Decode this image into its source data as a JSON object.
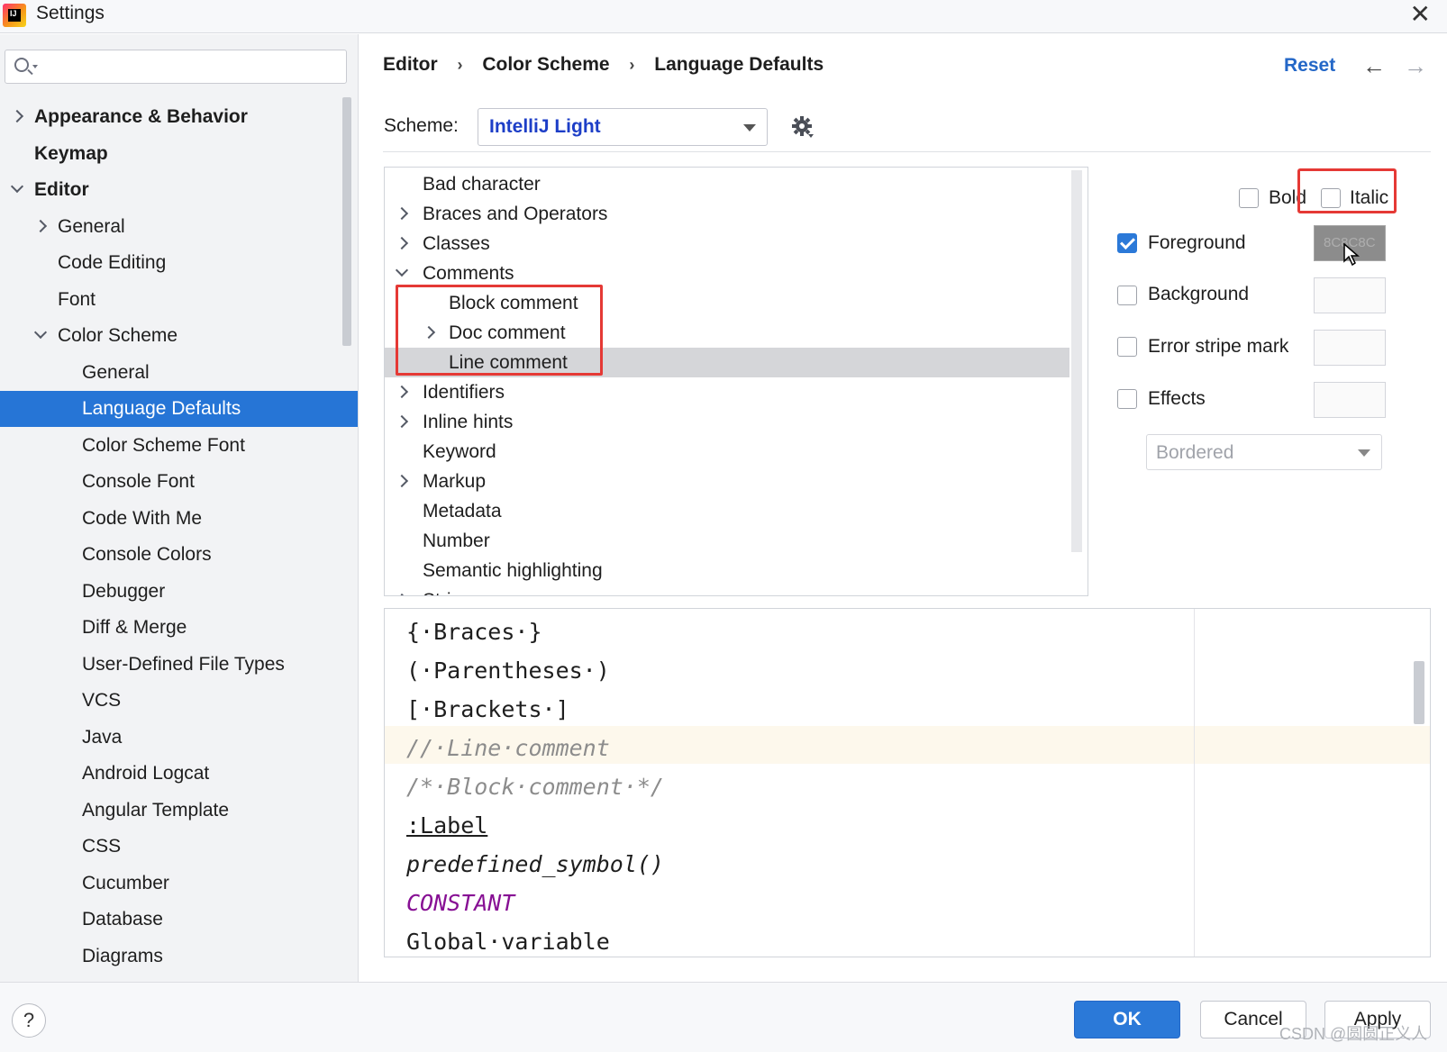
{
  "window": {
    "title": "Settings",
    "close_glyph": "✕"
  },
  "app_logo": {
    "icon": "intellij-logo-icon",
    "text": "IJ"
  },
  "search": {
    "value": "",
    "placeholder": ""
  },
  "sidebar": {
    "items": [
      {
        "label": "Appearance & Behavior",
        "level": 0,
        "arrow": "right",
        "bold": true
      },
      {
        "label": "Keymap",
        "level": 0,
        "arrow": "none",
        "bold": true
      },
      {
        "label": "Editor",
        "level": 0,
        "arrow": "down",
        "bold": true
      },
      {
        "label": "General",
        "level": 1,
        "arrow": "right"
      },
      {
        "label": "Code Editing",
        "level": 1,
        "arrow": "none"
      },
      {
        "label": "Font",
        "level": 1,
        "arrow": "none"
      },
      {
        "label": "Color Scheme",
        "level": 1,
        "arrow": "down"
      },
      {
        "label": "General",
        "level": 2,
        "arrow": "none"
      },
      {
        "label": "Language Defaults",
        "level": 2,
        "arrow": "none",
        "selected": true
      },
      {
        "label": "Color Scheme Font",
        "level": 2,
        "arrow": "none"
      },
      {
        "label": "Console Font",
        "level": 2,
        "arrow": "none"
      },
      {
        "label": "Code With Me",
        "level": 2,
        "arrow": "none"
      },
      {
        "label": "Console Colors",
        "level": 2,
        "arrow": "none"
      },
      {
        "label": "Debugger",
        "level": 2,
        "arrow": "none"
      },
      {
        "label": "Diff & Merge",
        "level": 2,
        "arrow": "none"
      },
      {
        "label": "User-Defined File Types",
        "level": 2,
        "arrow": "none"
      },
      {
        "label": "VCS",
        "level": 2,
        "arrow": "none"
      },
      {
        "label": "Java",
        "level": 2,
        "arrow": "none"
      },
      {
        "label": "Android Logcat",
        "level": 2,
        "arrow": "none"
      },
      {
        "label": "Angular Template",
        "level": 2,
        "arrow": "none"
      },
      {
        "label": "CSS",
        "level": 2,
        "arrow": "none"
      },
      {
        "label": "Cucumber",
        "level": 2,
        "arrow": "none"
      },
      {
        "label": "Database",
        "level": 2,
        "arrow": "none"
      },
      {
        "label": "Diagrams",
        "level": 2,
        "arrow": "none"
      }
    ]
  },
  "breadcrumb": {
    "items": [
      "Editor",
      "Color Scheme",
      "Language Defaults"
    ],
    "separator": "›"
  },
  "header": {
    "reset_label": "Reset",
    "back_glyph": "←",
    "forward_glyph": "→"
  },
  "scheme": {
    "label": "Scheme:",
    "value": "IntelliJ Light"
  },
  "attributes": {
    "rows": [
      {
        "label": "Bad character",
        "level": 0,
        "arrow": "none"
      },
      {
        "label": "Braces and Operators",
        "level": 0,
        "arrow": "right"
      },
      {
        "label": "Classes",
        "level": 0,
        "arrow": "right"
      },
      {
        "label": "Comments",
        "level": 0,
        "arrow": "down"
      },
      {
        "label": "Block comment",
        "level": 1,
        "arrow": "none"
      },
      {
        "label": "Doc comment",
        "level": 1,
        "arrow": "right"
      },
      {
        "label": "Line comment",
        "level": 1,
        "arrow": "none",
        "selected": true
      },
      {
        "label": "Identifiers",
        "level": 0,
        "arrow": "right"
      },
      {
        "label": "Inline hints",
        "level": 0,
        "arrow": "right"
      },
      {
        "label": "Keyword",
        "level": 0,
        "arrow": "none"
      },
      {
        "label": "Markup",
        "level": 0,
        "arrow": "right"
      },
      {
        "label": "Metadata",
        "level": 0,
        "arrow": "none"
      },
      {
        "label": "Number",
        "level": 0,
        "arrow": "none"
      },
      {
        "label": "Semantic highlighting",
        "level": 0,
        "arrow": "none"
      },
      {
        "label": "Strings",
        "level": 0,
        "arrow": "right"
      }
    ]
  },
  "properties": {
    "bold_label": "Bold",
    "bold_checked": false,
    "italic_label": "Italic",
    "italic_checked": false,
    "foreground_label": "Foreground",
    "foreground_checked": true,
    "foreground_color_text": "8C8C8C",
    "foreground_color": "#8c8c8c",
    "background_label": "Background",
    "background_checked": false,
    "error_stripe_label": "Error stripe mark",
    "error_stripe_checked": false,
    "effects_label": "Effects",
    "effects_checked": false,
    "effects_type": "Bordered"
  },
  "preview": {
    "lines": [
      {
        "text": "{·Braces·}",
        "style": "plain"
      },
      {
        "text": "(·Parentheses·)",
        "style": "plain"
      },
      {
        "text": "[·Brackets·]",
        "style": "plain"
      },
      {
        "text": "//·Line·comment",
        "style": "comment"
      },
      {
        "text": "/*·Block·comment·*/",
        "style": "comment"
      },
      {
        "text": ":Label",
        "style": "label"
      },
      {
        "text": "predefined_symbol()",
        "style": "italic"
      },
      {
        "text": "CONSTANT",
        "style": "constant"
      },
      {
        "text": "Global·variable",
        "style": "plain"
      }
    ]
  },
  "footer": {
    "help_label": "?",
    "ok_label": "OK",
    "cancel_label": "Cancel",
    "apply_label": "Apply"
  },
  "watermark": "CSDN @圆圆正义人",
  "colors": {
    "accent": "#2675d6",
    "ok_button": "#2b79d8",
    "reset_link": "#2467c7",
    "scheme_value": "#1d3ec7",
    "highlight_box": "#e53935",
    "comment_text": "#8c8c8c",
    "constant_text": "#871094"
  }
}
